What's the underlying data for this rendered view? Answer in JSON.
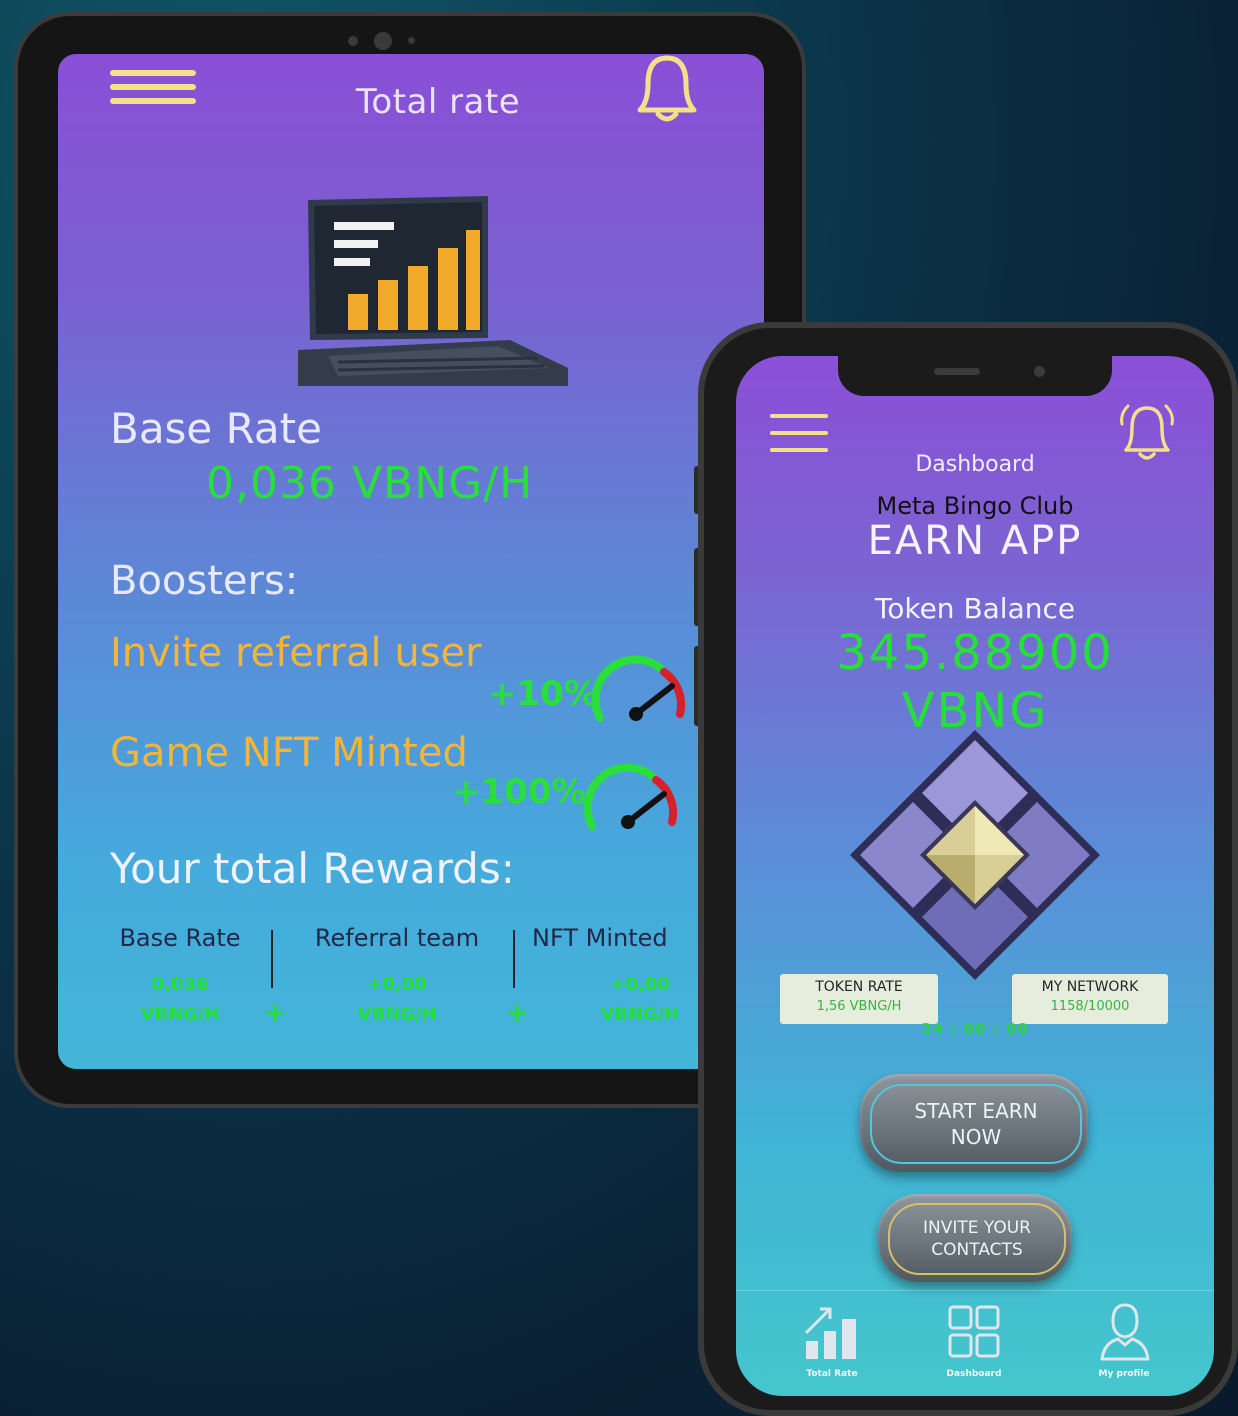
{
  "tablet": {
    "title": "Total rate",
    "base_rate_label": "Base Rate",
    "base_rate_value": "0,036 VBNG/H",
    "boosters_label": "Boosters:",
    "boosters": [
      {
        "name": "Invite referral user",
        "bonus": "+10%"
      },
      {
        "name": "Game NFT Minted",
        "bonus": "+100%"
      }
    ],
    "total_rewards_label": "Your total Rewards:",
    "rewards": [
      {
        "label": "Base Rate",
        "amount": "0,036",
        "unit": "VBNG/H"
      },
      {
        "label": "Referral team",
        "amount": "+0,00",
        "unit": "VBNG/H"
      },
      {
        "label": "NFT Minted",
        "amount": "+0,00",
        "unit": "VBNG/H"
      }
    ],
    "plus_sign": "+"
  },
  "phone": {
    "section": "Dashboard",
    "club": "Meta Bingo Club",
    "app_name": "EARN APP",
    "token_balance_label": "Token Balance",
    "token_balance_amount": "345.88900",
    "token_balance_unit": "VBNG",
    "token_rate": {
      "label": "TOKEN RATE",
      "value": "1,56 VBNG/H"
    },
    "my_network": {
      "label": "MY NETWORK",
      "value": "1158/10000"
    },
    "timer": "24 : 00 : 00",
    "start_button": "START EARN NOW",
    "invite_button": "INVITE YOUR CONTACTS",
    "tabs": [
      {
        "label": "Total Rate",
        "icon": "chart-icon"
      },
      {
        "label": "Dashboard",
        "icon": "grid-icon"
      },
      {
        "label": "My profile",
        "icon": "profile-icon"
      }
    ]
  },
  "colors": {
    "accent_green": "#28e03a",
    "accent_orange": "#f1b53a",
    "icon_yellow": "#f3e08a"
  }
}
